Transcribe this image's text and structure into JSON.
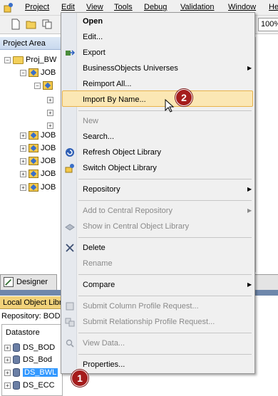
{
  "menubar": {
    "items": [
      "Project",
      "Edit",
      "View",
      "Tools",
      "Debug",
      "Validation",
      "Window",
      "He"
    ]
  },
  "toolbar": {
    "zoom_value": "100%"
  },
  "project_area": {
    "title": "Project Area",
    "root": "Proj_BW",
    "job_label": "JOB"
  },
  "designer_tab": {
    "label": "Designer"
  },
  "local_object_library": {
    "title": "Local Object Libr",
    "repository_label": "Repository: BOD",
    "datastore_title": "Datastore",
    "datastores": [
      "DS_BOD",
      "DS_Bod",
      "DS_BWL",
      "DS_ECC"
    ],
    "selected": "DS_BWL"
  },
  "context_menu": {
    "items": [
      {
        "label": "Open",
        "state": "bold"
      },
      {
        "label": "Edit...",
        "state": "normal"
      },
      {
        "label": "Export",
        "state": "normal",
        "icon": "export-icon"
      },
      {
        "label": "BusinessObjects Universes",
        "state": "normal",
        "submenu": true
      },
      {
        "label": "Reimport All...",
        "state": "normal"
      },
      {
        "label": "Import By Name...",
        "state": "highlighted"
      },
      {
        "label": "New",
        "state": "disabled"
      },
      {
        "label": "Search...",
        "state": "normal"
      },
      {
        "label": "Refresh Object Library",
        "state": "normal",
        "icon": "refresh-icon"
      },
      {
        "label": "Switch Object Library",
        "state": "normal",
        "icon": "switch-library-icon"
      },
      {
        "label": "Repository",
        "state": "normal",
        "submenu": true
      },
      {
        "label": "Add to Central Repository",
        "state": "disabled",
        "submenu": true
      },
      {
        "label": "Show in Central Object Library",
        "state": "disabled",
        "icon": "central-library-icon"
      },
      {
        "label": "Delete",
        "state": "normal",
        "icon": "delete-icon"
      },
      {
        "label": "Rename",
        "state": "disabled"
      },
      {
        "label": "Compare",
        "state": "normal",
        "submenu": true
      },
      {
        "label": "Submit Column Profile Request...",
        "state": "disabled",
        "icon": "column-profile-icon"
      },
      {
        "label": "Submit Relationship Profile Request...",
        "state": "disabled",
        "icon": "relationship-profile-icon"
      },
      {
        "label": "View Data...",
        "state": "disabled",
        "icon": "view-data-icon"
      },
      {
        "label": "Properties...",
        "state": "normal"
      }
    ]
  },
  "annotations": {
    "badge_1": "1",
    "badge_2": "2"
  },
  "colors": {
    "highlight_fill": "#fbe7b4",
    "highlight_border": "#e8b24a",
    "badge": "#a51c1c",
    "library_header": "#f1d27a",
    "selection": "#3399ff"
  }
}
